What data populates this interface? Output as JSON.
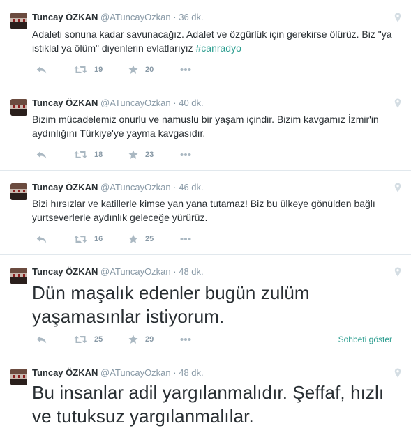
{
  "tweets": [
    {
      "fullname": "Tuncay ÖZKAN",
      "username": "@ATuncayOzkan",
      "separator": "·",
      "time": "36 dk.",
      "text_before": "Adaleti sonuna kadar savunacağız. Adalet ve özgürlük için gerekirse ölürüz. Biz \"ya istiklal ya ölüm\" diyenlerin evlatlarıyız ",
      "hashtag": "#canradyo",
      "retweets": "19",
      "favorites": "20"
    },
    {
      "fullname": "Tuncay ÖZKAN",
      "username": "@ATuncayOzkan",
      "separator": "·",
      "time": "40 dk.",
      "text": "Bizim mücadelemiz onurlu ve namuslu bir yaşam içindir. Bizim kavgamız İzmir'in aydınlığını Türkiye'ye yayma kavgasıdır.",
      "retweets": "18",
      "favorites": "23"
    },
    {
      "fullname": "Tuncay ÖZKAN",
      "username": "@ATuncayOzkan",
      "separator": "·",
      "time": "46 dk.",
      "text": "Bizi hırsızlar ve katillerle kimse yan yana tutamaz! Biz bu ülkeye gönülden bağlı yurtseverlerle aydınlık geleceğe yürürüz.",
      "retweets": "16",
      "favorites": "25"
    },
    {
      "fullname": "Tuncay ÖZKAN",
      "username": "@ATuncayOzkan",
      "separator": "·",
      "time": "48 dk.",
      "text": "Dün maşalık edenler bugün zulüm yaşamasınlar istiyorum.",
      "retweets": "25",
      "favorites": "29",
      "conversation": "Sohbeti göster"
    },
    {
      "fullname": "Tuncay ÖZKAN",
      "username": "@ATuncayOzkan",
      "separator": "·",
      "time": "48 dk.",
      "text": "Bu insanlar adil yargılanmalıdır. Şeffaf, hızlı ve tutuksuz yargılanmalılar."
    }
  ],
  "colors": {
    "hashtag": "#2b9d8f",
    "meta": "#8899a6",
    "icon": "#aab8c2"
  },
  "icons": [
    "reply-icon",
    "retweet-icon",
    "favorite-icon",
    "more-icon",
    "geo-pin-icon"
  ]
}
